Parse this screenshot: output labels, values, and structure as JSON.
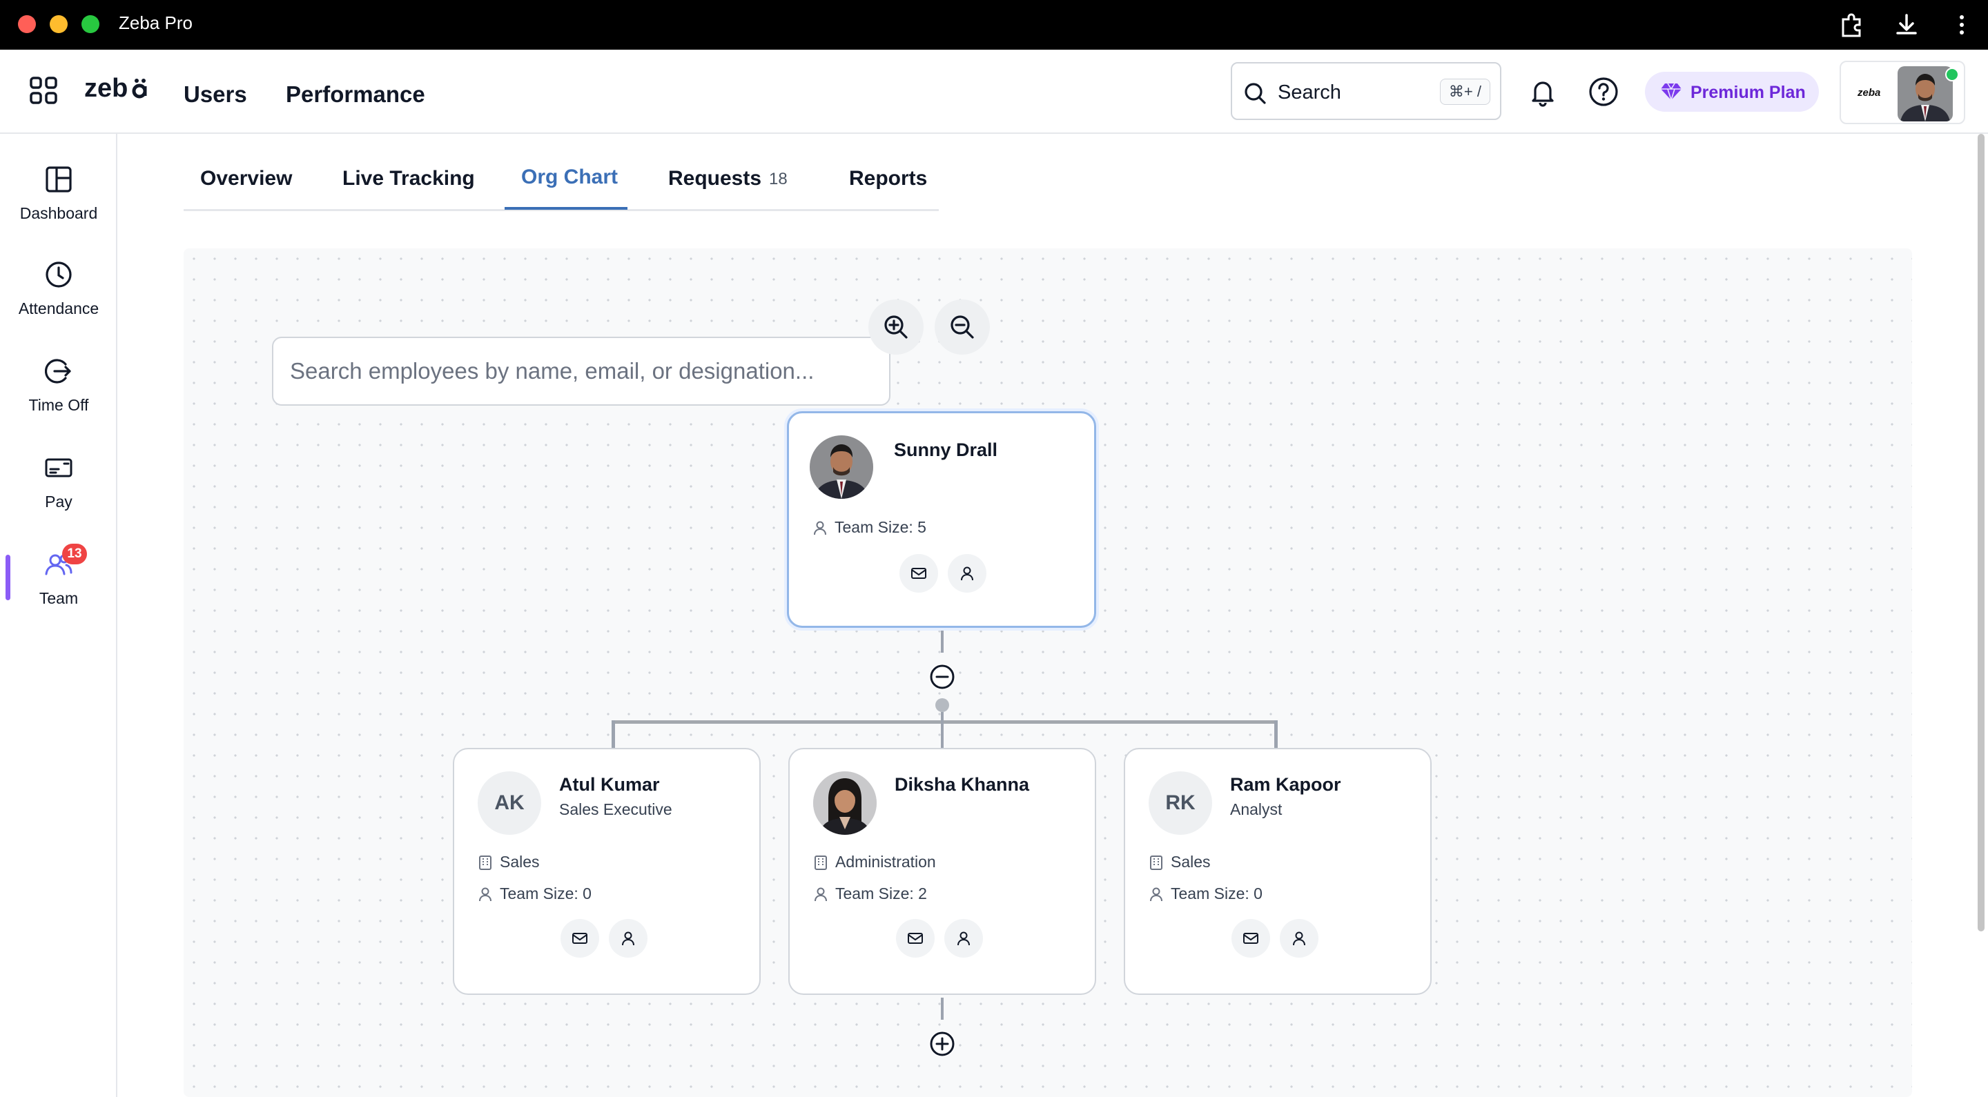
{
  "window": {
    "title": "Zeba Pro"
  },
  "header": {
    "logo_text": "zeba",
    "nav": [
      "Users",
      "Performance"
    ],
    "search": {
      "label": "Search",
      "shortcut": "⌘+ /"
    },
    "premium_label": "Premium Plan",
    "profile_logo": "zeba"
  },
  "sidebar": {
    "items": [
      {
        "label": "Dashboard",
        "icon": "dashboard-icon"
      },
      {
        "label": "Attendance",
        "icon": "clock-icon"
      },
      {
        "label": "Time Off",
        "icon": "exit-icon"
      },
      {
        "label": "Pay",
        "icon": "card-icon"
      },
      {
        "label": "Team",
        "icon": "team-icon",
        "badge": "13",
        "active": true
      }
    ]
  },
  "tabs": [
    {
      "label": "Overview"
    },
    {
      "label": "Live Tracking"
    },
    {
      "label": "Org Chart",
      "active": true
    },
    {
      "label": "Requests",
      "count": "18"
    },
    {
      "label": "Reports"
    }
  ],
  "org_chart": {
    "search_placeholder": "Search employees by name, email, or designation...",
    "root": {
      "name": "Sunny Drall",
      "team_size": "Team Size: 5"
    },
    "children": [
      {
        "initials": "AK",
        "name": "Atul Kumar",
        "role": "Sales Executive",
        "department": "Sales",
        "team_size": "Team Size: 0"
      },
      {
        "initials": "",
        "name": "Diksha Khanna",
        "role": "",
        "department": "Administration",
        "team_size": "Team Size: 2"
      },
      {
        "initials": "RK",
        "name": "Ram Kapoor",
        "role": "Analyst",
        "department": "Sales",
        "team_size": "Team Size: 0"
      }
    ]
  },
  "colors": {
    "accent": "#3b6fb6",
    "premium": "#6d28d9",
    "badge": "#ef4444",
    "active_bar": "#8b5cf6"
  }
}
